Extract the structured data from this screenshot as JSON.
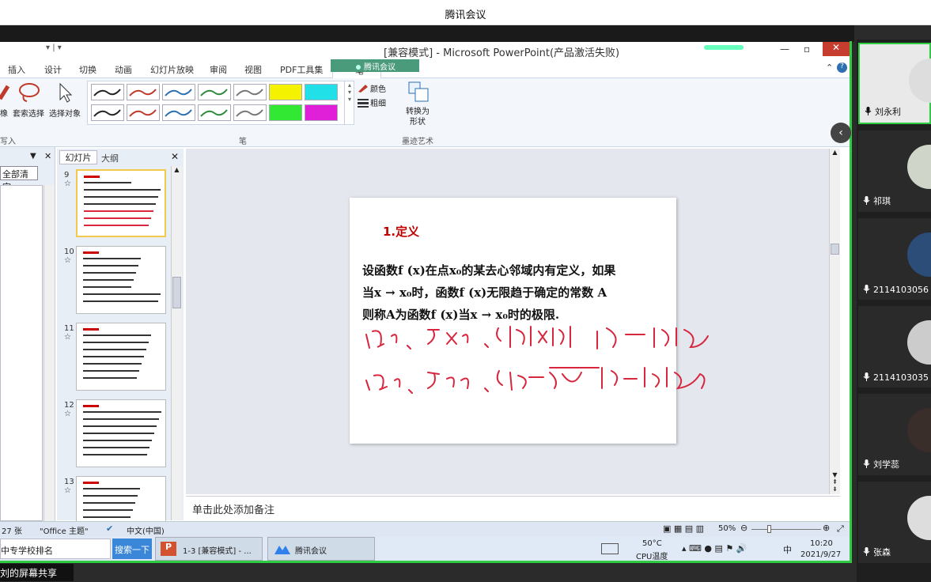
{
  "meeting": {
    "title": "腾讯会议",
    "share_label": "刘的屏幕共享"
  },
  "powerpoint": {
    "window_title": "[兼容模式] - Microsoft PowerPoint(产品激活失败)",
    "meeting_badge": "腾讯会议",
    "tabs": [
      "插入",
      "设计",
      "切换",
      "动画",
      "幻灯片放映",
      "审阅",
      "视图",
      "PDF工具集",
      "笔"
    ],
    "active_tab": "笔",
    "ribbon": {
      "erase_label": "橡",
      "lasso_label": "套索选择",
      "select_label": "选择对象",
      "group_write": "写入",
      "group_pens": "笔",
      "color_label": "颜色",
      "thickness_label": "粗细",
      "convert_label": "转换为形状",
      "group_ink": "墨迹艺术",
      "pen_colors": [
        "#222222",
        "#c0392b",
        "#2e6fb0",
        "#2e8b3d",
        "#777777",
        "#f5f200",
        "#22e0e8",
        "#222222",
        "#c0392b",
        "#2e6fb0",
        "#2e8b3d",
        "#777777",
        "#33e833",
        "#e020d8"
      ]
    },
    "left_pane": {
      "clear_all": "全部清空"
    },
    "thumb_tabs": {
      "slides": "幻灯片",
      "outline": "大纲"
    },
    "thumbnails": [
      {
        "num": "9",
        "star": "☆"
      },
      {
        "num": "10",
        "star": "☆"
      },
      {
        "num": "11",
        "star": "☆"
      },
      {
        "num": "12",
        "star": "☆"
      },
      {
        "num": "13",
        "star": "☆"
      }
    ],
    "slide": {
      "heading": "1.定义",
      "line1": "设函数f (x)在点x₀的某去心邻域内有定义，如果",
      "line2": "当x → x₀时，函数f (x)无限趋于确定的常数 A",
      "line3": "则称A为函数f (x)当x → x₀时的极限."
    },
    "notes_placeholder": "单击此处添加备注",
    "status": {
      "slide_count": "27 张",
      "theme": "\"Office 主题\"",
      "language": "中文(中国)",
      "zoom": "50%"
    },
    "taskbar": {
      "search_text": "中专学校排名",
      "search_button": "搜索一下",
      "ppt_task": "1-3 [兼容模式] - ...",
      "meeting_task": "腾讯会议",
      "temp": "50°C",
      "temp_label": "CPU温度",
      "ime": "中",
      "time": "10:20",
      "date": "2021/9/27"
    }
  },
  "participants": [
    {
      "name": "刘永利"
    },
    {
      "name": "祁琪"
    },
    {
      "name": "2114103056"
    },
    {
      "name": "2114103035"
    },
    {
      "name": "刘学蕊"
    },
    {
      "name": "张森"
    }
  ]
}
